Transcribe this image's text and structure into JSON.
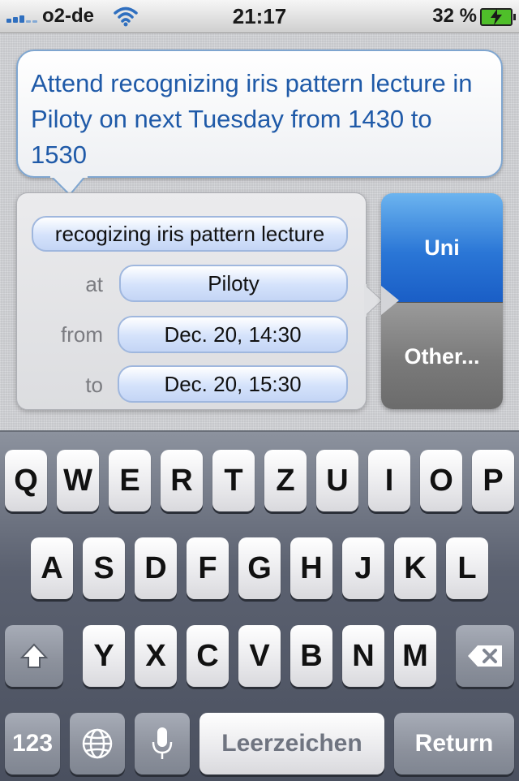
{
  "status_bar": {
    "carrier": "o2-de",
    "time": "21:17",
    "battery": "32 %",
    "signal_bars": 5,
    "signal_strength": 3,
    "battery_level_percent": 32,
    "charging": true
  },
  "bubble": {
    "text": "Attend recognizing iris pattern lecture in Piloty on next Tuesday from 1430 to 1530"
  },
  "event": {
    "title": "recogizing iris pattern lecture",
    "at_label": "at",
    "at_value": "Piloty",
    "from_label": "from",
    "from_value": "Dec. 20, 14:30",
    "to_label": "to",
    "to_value": "Dec. 20, 15:30"
  },
  "calendar_choice": {
    "selected": "Uni",
    "other": "Other..."
  },
  "keyboard": {
    "row1": [
      "Q",
      "W",
      "E",
      "R",
      "T",
      "Z",
      "U",
      "I",
      "O",
      "P"
    ],
    "row2": [
      "A",
      "S",
      "D",
      "F",
      "G",
      "H",
      "J",
      "K",
      "L"
    ],
    "row3": [
      "Y",
      "X",
      "C",
      "V",
      "B",
      "N",
      "M"
    ],
    "numbers_label": "123",
    "space_label": "Leerzeichen",
    "return_label": "Return"
  },
  "colors": {
    "accent_blue": "#1f5aa8",
    "selected_blue": "#2a76d6",
    "pill_border": "#9fb7de"
  },
  "icons": {
    "signal": "signal-bars-icon",
    "wifi": "wifi-icon",
    "battery": "battery-charging-icon",
    "shift": "shift-arrow-icon",
    "globe": "globe-icon",
    "mic": "microphone-icon",
    "backspace": "backspace-icon"
  }
}
